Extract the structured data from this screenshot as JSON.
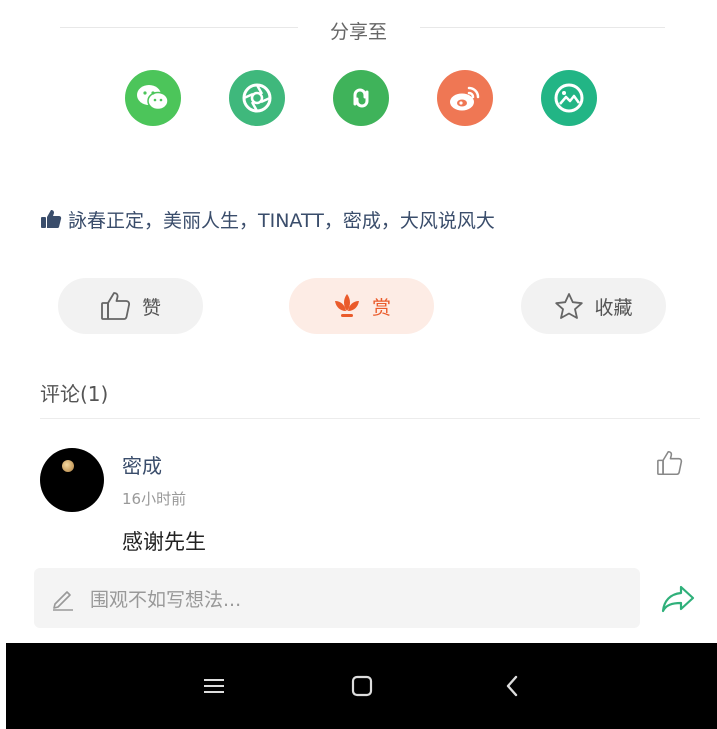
{
  "share": {
    "title": "分享至",
    "icons": [
      {
        "name": "wechat-icon",
        "color": "#4cc55a"
      },
      {
        "name": "moments-icon",
        "color": "#3fb87c"
      },
      {
        "name": "link-icon",
        "color": "#3fb35a"
      },
      {
        "name": "weibo-icon",
        "color": "#ef7754"
      },
      {
        "name": "album-icon",
        "color": "#22b585"
      }
    ]
  },
  "likes": {
    "icon": "thumb-up-icon",
    "text": "詠春正定，美丽人生，TINATT，密成，大风说风大"
  },
  "actions": {
    "like_label": "赞",
    "reward_label": "赏",
    "favorite_label": "收藏",
    "reward_color": "#ea5b2b"
  },
  "comments": {
    "title": "评论(1)",
    "items": [
      {
        "user": "密成",
        "time": "16小时前",
        "text": "感谢先生"
      }
    ]
  },
  "input": {
    "placeholder": "围观不如写想法..."
  },
  "navbar": {
    "icons": [
      "menu-icon",
      "home-icon",
      "back-icon"
    ]
  }
}
